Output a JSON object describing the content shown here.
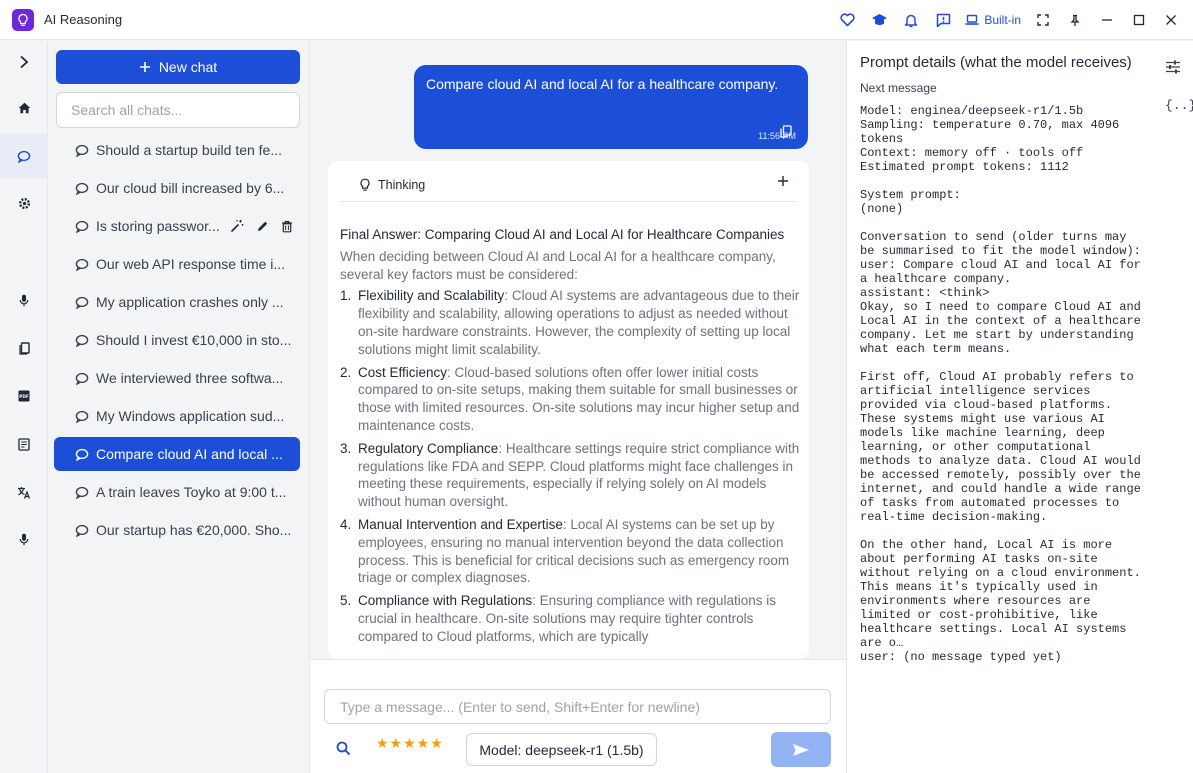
{
  "window": {
    "title": "AI Reasoning",
    "builtin_label": "Built-in"
  },
  "sidebar": {
    "new_chat_label": "New chat",
    "search_placeholder": "Search all chats...",
    "chats": [
      "Should a startup build ten fe...",
      "Our cloud bill increased by 6...",
      "Is storing passwor...",
      "Our web API response time i...",
      "My application crashes only ...",
      "Should I invest €10,000 in sto...",
      "We interviewed three softwa...",
      "My Windows application sud...",
      "Compare cloud AI and local ...",
      "A train leaves Toyko at 9:00 t...",
      "Our startup has €20,000. Sho..."
    ],
    "active_chat_index": 8
  },
  "conversation": {
    "user_message": "Compare cloud AI and local AI for a healthcare company.",
    "user_time": "11:56 PM",
    "thinking_label": "Thinking",
    "answer_title": "Final Answer: Comparing Cloud AI and Local AI for Healthcare Companies",
    "answer_intro": "When deciding between Cloud AI and Local AI for a healthcare company, several key factors must be considered:",
    "points": [
      {
        "num": "1.",
        "title": "Flexibility and Scalability",
        "text": ": Cloud AI systems are advantageous due to their flexibility and scalability, allowing operations to adjust as needed without on-site hardware constraints. However, the complexity of setting up local solutions might limit scalability."
      },
      {
        "num": "2.",
        "title": "Cost Efficiency",
        "text": ": Cloud-based solutions often offer lower initial costs compared to on-site setups, making them suitable for small businesses or those with limited resources. On-site solutions may incur higher setup and maintenance costs."
      },
      {
        "num": "3.",
        "title": "Regulatory Compliance",
        "text": ": Healthcare settings require strict compliance with regulations like FDA and SEPP. Cloud platforms might face challenges in meeting these requirements, especially if relying solely on AI models without human oversight."
      },
      {
        "num": "4.",
        "title": "Manual Intervention and Expertise",
        "text": ": Local AI systems can be set up by employees, ensuring no manual intervention beyond the data collection process. This is beneficial for critical decisions such as emergency room triage or complex diagnoses."
      },
      {
        "num": "5.",
        "title": "Compliance with Regulations",
        "text": ": Ensuring compliance with regulations is crucial in healthcare. On-site solutions may require tighter controls compared to Cloud platforms, which are typically"
      }
    ]
  },
  "composer": {
    "placeholder": "Type a message...  (Enter to send, Shift+Enter for newline)",
    "rating": "★★★★★",
    "model_label": "Model: deepseek-r1 (1.5b)"
  },
  "prompt_panel": {
    "title": "Prompt details (what the model receives)",
    "subtitle": "Next message",
    "details": "Model: enginea/deepseek-r1/1.5b\nSampling: temperature 0.70, max 4096\ntokens\nContext: memory off · tools off\nEstimated prompt tokens: 1112\n\nSystem prompt:\n(none)\n\nConversation to send (older turns may\nbe summarised to fit the model window):\nuser: Compare cloud AI and local AI for\na healthcare company.\nassistant: <think>\nOkay, so I need to compare Cloud AI and\nLocal AI in the context of a healthcare\ncompany. Let me start by understanding\nwhat each term means.\n\nFirst off, Cloud AI probably refers to\nartificial intelligence services\nprovided via cloud-based platforms.\nThese systems might use various AI\nmodels like machine learning, deep\nlearning, or other computational\nmethods to analyze data. Cloud AI would\nbe accessed remotely, possibly over the\ninternet, and could handle a wide range\nof tasks from automated processes to\nreal-time decision-making.\n\nOn the other hand, Local AI is more\nabout performing AI tasks on-site\nwithout relying on a cloud environment.\nThis means it's typically used in\nenvironments where resources are\nlimited or cost-prohibitive, like\nhealthcare settings. Local AI systems\nare o…\nuser: (no message typed yet)",
    "tools_icon_text": "{..}"
  },
  "colors": {
    "accent": "#1d4ed8",
    "brand": "#6d28d9",
    "star": "#f59e0b"
  }
}
